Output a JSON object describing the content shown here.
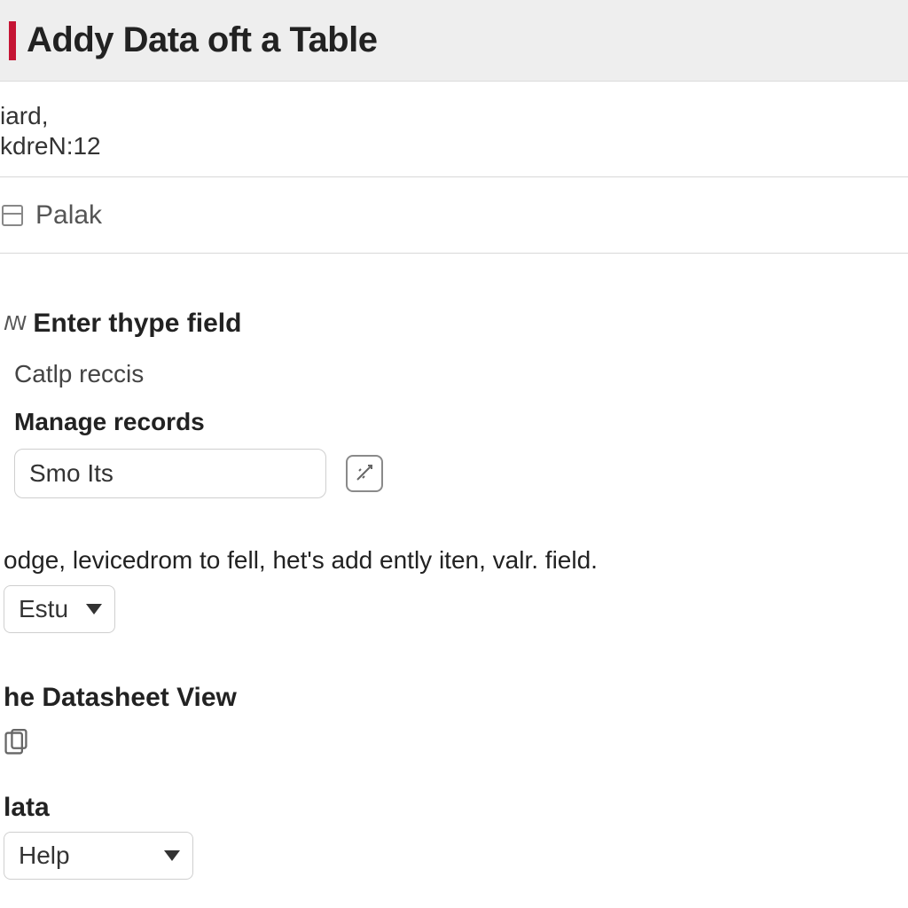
{
  "titlebar": {
    "title": "Addy Data oft a Table"
  },
  "meta": {
    "line1": "iard,",
    "line2": "kdreN:12"
  },
  "object": {
    "name": "Palak"
  },
  "form": {
    "enter_label": "Enter thype field",
    "hint_prefix": "ꟿ",
    "catlp": "Catlp reccis",
    "manage_label": "Manage records",
    "input_value": "Smo Its",
    "description": "odge, levicedrom to fell, het's add  ently iten, valr. field.",
    "select1": "Estu",
    "datasheet_label": "he Datasheet View",
    "data_label": "lata",
    "select2": "Help"
  }
}
